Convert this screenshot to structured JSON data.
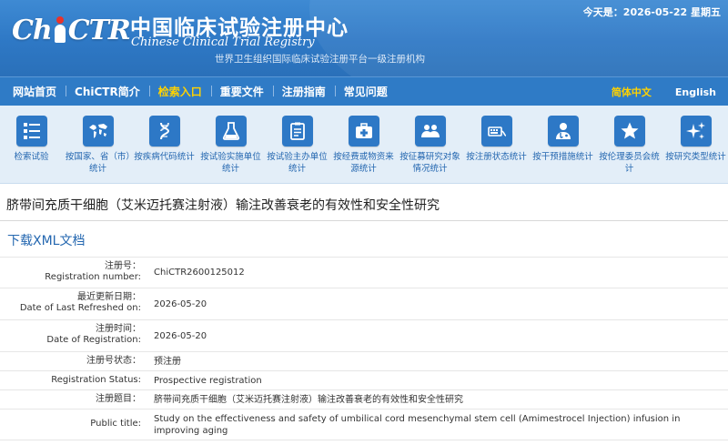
{
  "header": {
    "logo_prefix": "Ch",
    "logo_suffix": "CTR",
    "cn_title": "中国临床试验注册中心",
    "en_title": "Chinese Clinical Trial Registry",
    "subtitle": "世界卫生组织国际临床试验注册平台一级注册机构",
    "date_text": "今天是：2026-05-22 星期五"
  },
  "nav": {
    "items": [
      "网站首页",
      "ChiCTR简介",
      "检索入口",
      "重要文件",
      "注册指南",
      "常见问题"
    ],
    "active_index": 2,
    "lang_cn": "简体中文",
    "lang_en": "English"
  },
  "icons": [
    {
      "name": "list-icon",
      "label": "检索试验"
    },
    {
      "name": "world-map-icon",
      "label": "按国家、省（市）统计"
    },
    {
      "name": "dna-icon",
      "label": "按疾病代码统计"
    },
    {
      "name": "flask-icon",
      "label": "按试验实施单位统计"
    },
    {
      "name": "clipboard-icon",
      "label": "按试验主办单位统计"
    },
    {
      "name": "medical-kit-icon",
      "label": "按经费或物资来源统计"
    },
    {
      "name": "people-icon",
      "label": "按征募研究对象情况统计"
    },
    {
      "name": "registration-status-icon",
      "label": "按注册状态统计"
    },
    {
      "name": "doctor-icon",
      "label": "按干预措施统计"
    },
    {
      "name": "star-icon",
      "label": "按伦理委员会统计"
    },
    {
      "name": "sparkle-icon",
      "label": "按研究类型统计"
    }
  ],
  "study": {
    "title": "脐带间充质干细胞（艾米迈托赛注射液）输注改善衰老的有效性和安全性研究",
    "xml_link": "下载XML文档"
  },
  "details": [
    {
      "label_cn": "注册号：",
      "label_en": "Registration number:",
      "value": "ChiCTR2600125012"
    },
    {
      "label_cn": "最近更新日期：",
      "label_en": "Date of Last Refreshed on:",
      "value": "2026-05-20"
    },
    {
      "label_cn": "注册时间：",
      "label_en": "Date of Registration:",
      "value": "2026-05-20"
    },
    {
      "label_cn": "注册号状态：",
      "label_en": "",
      "value": "预注册"
    },
    {
      "label_cn": "",
      "label_en": "Registration Status:",
      "value": "Prospective registration"
    },
    {
      "label_cn": "注册题目：",
      "label_en": "",
      "value": "脐带间充质干细胞（艾米迈托赛注射液）输注改善衰老的有效性和安全性研究"
    },
    {
      "label_cn": "",
      "label_en": "Public title:",
      "value": "Study on the effectiveness and safety of umbilical cord mesenchymal stem cell (Amimestrocel Injection) infusion in improving aging"
    }
  ],
  "colors": {
    "header_blue": "#2e78c5",
    "nav_active": "#ffd200",
    "link_blue": "#2467b0",
    "icon_bar_bg": "#e3eef8"
  }
}
